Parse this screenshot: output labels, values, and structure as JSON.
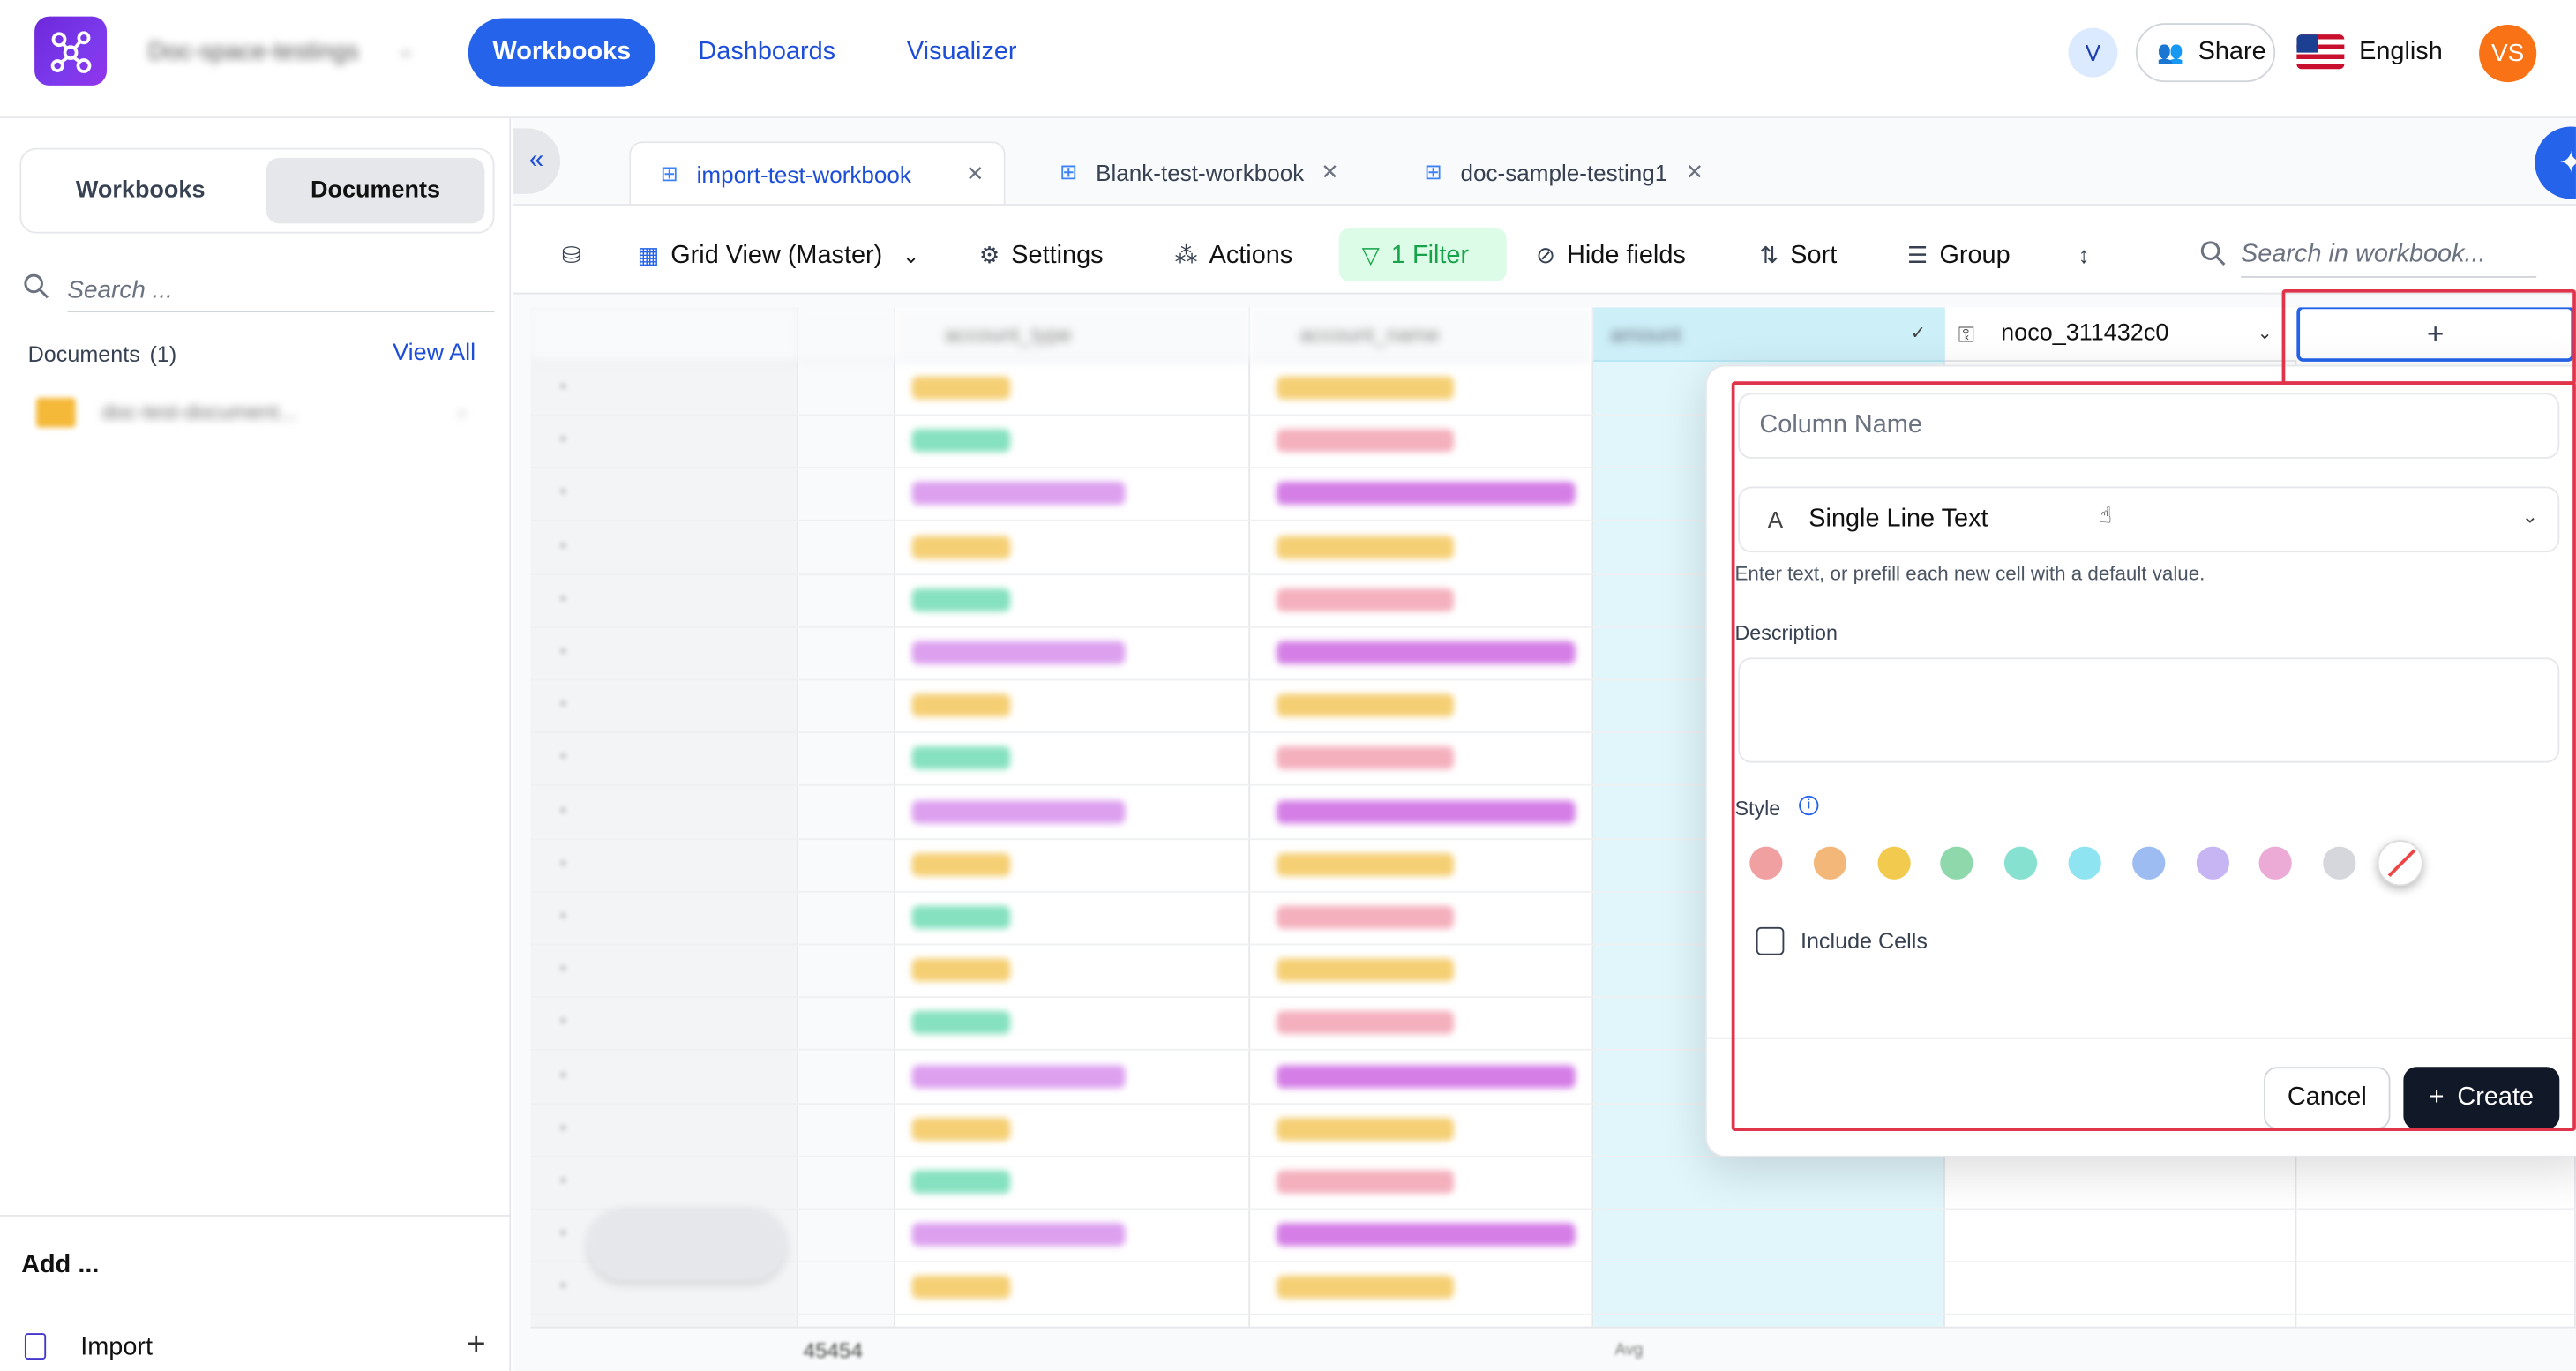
{
  "topbar": {
    "workspace_name": "Doc-space-testings",
    "nav_tabs": [
      "Workbooks",
      "Dashboards",
      "Visualizer"
    ],
    "user_initial": "V",
    "share_label": "Share",
    "language": "English",
    "avatar_initials": "VS"
  },
  "sidebar": {
    "segments": [
      "Workbooks",
      "Documents"
    ],
    "search_placeholder": "Search ...",
    "documents_label": "Documents",
    "documents_count": "(1)",
    "view_all": "View All",
    "doc_item": "doc-test-document...",
    "add_label": "Add ...",
    "import_label": "Import"
  },
  "workbook_tabs": [
    {
      "label": "import-test-workbook",
      "active": true
    },
    {
      "label": "Blank-test-workbook",
      "active": false
    },
    {
      "label": "doc-sample-testing1",
      "active": false
    }
  ],
  "toolbar": {
    "view_label": "Grid View (Master)",
    "settings": "Settings",
    "actions": "Actions",
    "filter": "1 Filter",
    "hide_fields": "Hide fields",
    "sort": "Sort",
    "group": "Group",
    "search_placeholder": "Search in workbook..."
  },
  "grid": {
    "headers": [
      "account_type",
      "account_name",
      "amount",
      "noco_311432c0"
    ],
    "footer_count": "45454",
    "footer_avg": "Avg"
  },
  "popover": {
    "column_name_placeholder": "Column Name",
    "type_label": "Single Line Text",
    "type_hint": "Enter text, or prefill each new cell with a default value.",
    "description_label": "Description",
    "style_label": "Style",
    "style_colors": [
      "#f0a0a0",
      "#f3b77a",
      "#f2cb4e",
      "#8ed8ac",
      "#86e1d0",
      "#8fe4f2",
      "#9dbcf1",
      "#c6b4f3",
      "#ecaad6",
      "#d5d7dc"
    ],
    "include_cells": "Include Cells",
    "cancel": "Cancel",
    "create": "Create"
  },
  "colors": {
    "accent": "#2563eb",
    "highlight": "#e0344b",
    "filter_bg": "#dcfce7",
    "amount_column": "#e0f6fb"
  },
  "icons": {
    "search": "search-icon",
    "share": "people-icon",
    "filter": "funnel-icon",
    "ai": "sparkle-icon"
  }
}
